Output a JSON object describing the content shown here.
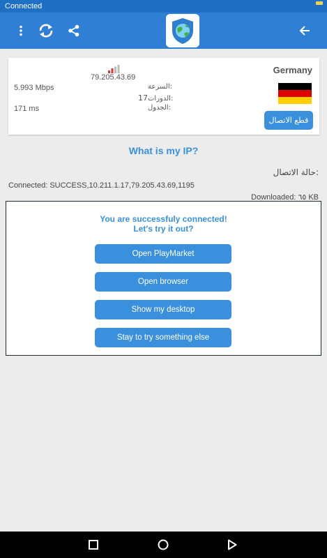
{
  "status_bar": {
    "text": "Connected"
  },
  "app_bar": {
    "icons": [
      "more-vert-icon",
      "refresh-icon",
      "share-icon",
      "app-logo-shield-globe",
      "back-arrow-icon"
    ]
  },
  "server": {
    "ip": "79.205.43.69",
    "speed_label": "السرعة:",
    "speed_value": "5.993 Mbps",
    "sessions_label": "الدورات:",
    "sessions_value": "17",
    "ping_label": "الجدول:",
    "ping_value": "171 ms",
    "country": "Germany",
    "flag_colors": [
      "#000000",
      "#dd0000",
      "#ffce00"
    ],
    "disconnect_label": "قطع الاتصال"
  },
  "what_is_my_ip": "What is my IP?",
  "connection": {
    "status_label": "حالة الاتصال:",
    "status_value": "Connected: SUCCESS,10.211.1.17,79.205.43.69,1195",
    "downloaded": "Downloaded: ٦٥ KB"
  },
  "dialog": {
    "line1": "You are successfuly connected!",
    "line2": "Let's try it out?",
    "buttons": [
      "Open PlayMarket",
      "Open browser",
      "Show my desktop",
      "Stay to try something else"
    ]
  },
  "colors": {
    "primary": "#2f80d5",
    "status_bar": "#1f6fc4",
    "button": "#3a90dc"
  }
}
